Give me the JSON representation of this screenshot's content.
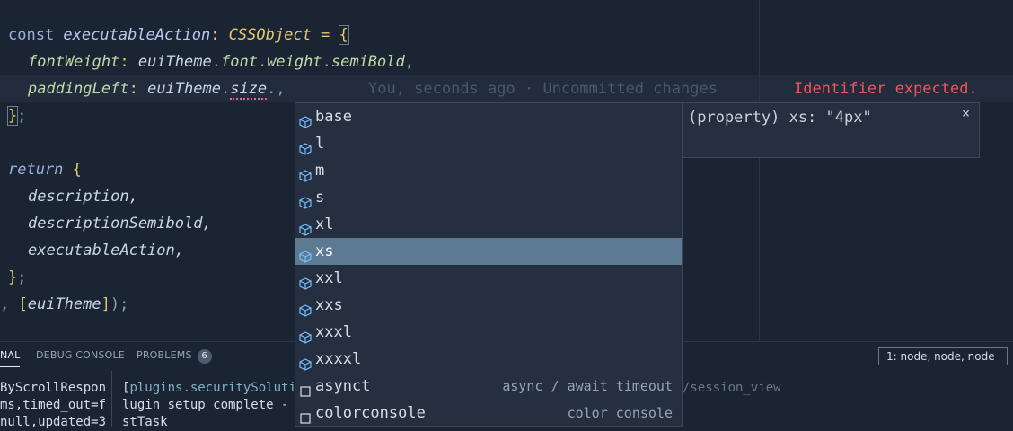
{
  "code": {
    "l1_const": "const ",
    "l1_name": "executableAction",
    "l1_colon": ": ",
    "l1_type": "CSSObject",
    "l1_eq": " = ",
    "l1_brace": "{",
    "l2_prop": "fontWeight",
    "l2_colon": ": ",
    "l2_obj": "euiTheme",
    "l2_dot1": ".",
    "l2_font": "font",
    "l2_dot2": ".",
    "l2_weight": "weight",
    "l2_dot3": ".",
    "l2_semi": "semiBold",
    "l2_comma": ",",
    "l3_prop": "paddingLeft",
    "l3_colon": ": ",
    "l3_obj": "euiTheme",
    "l3_dot": ".",
    "l3_size": "size",
    "l3_dot2": ".",
    "l3_comma": ",",
    "l4_close": "}",
    "l4_semi": ";",
    "l6_return": "return ",
    "l6_brace": "{",
    "l7": "description,",
    "l8": "descriptionSemibold,",
    "l9": "executableAction,",
    "l10_close": "}",
    "l10_semi": ";",
    "l11_comma": ", ",
    "l11_open": "[",
    "l11_var": "euiTheme",
    "l11_close": "]",
    "l11_end": ");",
    "blame": "You, seconds ago · Uncommitted changes",
    "error": "Identifier expected."
  },
  "suggest": {
    "items": [
      {
        "label": "base",
        "icon": "property-icon"
      },
      {
        "label": "l",
        "icon": "property-icon"
      },
      {
        "label": "m",
        "icon": "property-icon"
      },
      {
        "label": "s",
        "icon": "property-icon"
      },
      {
        "label": "xl",
        "icon": "property-icon"
      },
      {
        "label": "xs",
        "icon": "property-icon",
        "selected": true
      },
      {
        "label": "xxl",
        "icon": "property-icon"
      },
      {
        "label": "xxs",
        "icon": "property-icon"
      },
      {
        "label": "xxxl",
        "icon": "property-icon"
      },
      {
        "label": "xxxxl",
        "icon": "property-icon"
      },
      {
        "label": "asynct",
        "icon": "snippet-icon",
        "detail": "async / await timeout"
      },
      {
        "label": "colorconsole",
        "icon": "snippet-icon",
        "detail": "color console"
      }
    ],
    "details_text": "(property) xs: \"4px\"",
    "close_glyph": "×"
  },
  "panel": {
    "tab_terminal": "NAL",
    "tab_debug": "DEBUG CONSOLE",
    "tab_problems": "PROBLEMS",
    "problems_count": "6",
    "terminal_select": "1: node, node, node",
    "left_lines": [
      "ByScrollRespon",
      "ms,timed_out=f",
      "null,updated=3"
    ],
    "right_line1_a": "[",
    "right_line1_b": "plugins.securitySolution",
    "right_line2": "lugin setup complete - S",
    "right_line3": "stTask",
    "right_path": "/session_view"
  },
  "colors": {
    "background": "#1b2433",
    "selection": "#5d7a93",
    "error": "#e8575e",
    "accent": "#e7c86e"
  }
}
